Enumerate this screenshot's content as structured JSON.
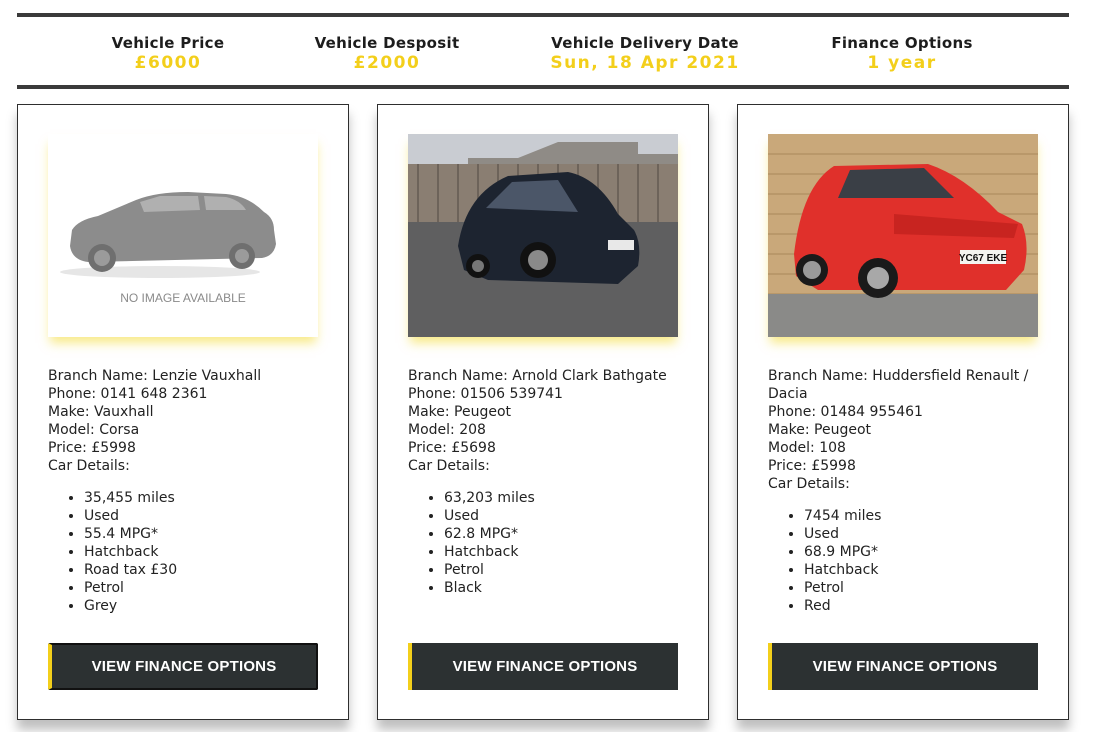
{
  "summary": [
    {
      "label": "Vehicle Price",
      "value": "£6000"
    },
    {
      "label": "Vehicle Desposit",
      "value": "£2000"
    },
    {
      "label": "Vehicle Delivery Date",
      "value": "Sun, 18 Apr 2021"
    },
    {
      "label": "Finance Options",
      "value": "1 year"
    }
  ],
  "colors": {
    "accent": "#f3cf1b",
    "button_bg": "#2c3132",
    "rule": "#3a3a3a"
  },
  "cards": [
    {
      "image_text": "NO IMAGE AVAILABLE",
      "branch": "Branch Name: Lenzie Vauxhall",
      "phone": "Phone: 0141 648 2361",
      "make": "Make: Vauxhall",
      "model": "Model: Corsa",
      "price": "Price: £5998",
      "details_label": "Car Details:",
      "details": [
        "35,455 miles",
        "Used",
        "55.4 MPG*",
        "Hatchback",
        "Road tax £30",
        "Petrol",
        "Grey"
      ],
      "button_label": "VIEW FINANCE OPTIONS"
    },
    {
      "branch": "Branch Name: Arnold Clark Bathgate",
      "phone": "Phone: 01506 539741",
      "make": "Make: Peugeot",
      "model": "Model: 208",
      "price": "Price: £5698",
      "details_label": "Car Details:",
      "details": [
        "63,203 miles",
        "Used",
        "62.8 MPG*",
        "Hatchback",
        "Petrol",
        "Black"
      ],
      "button_label": "VIEW FINANCE OPTIONS"
    },
    {
      "plate": "YC67 EKE",
      "branch": "Branch Name: Huddersfield Renault / Dacia",
      "phone": "Phone: 01484 955461",
      "make": "Make: Peugeot",
      "model": "Model: 108",
      "price": "Price: £5998",
      "details_label": "Car Details:",
      "details": [
        "7454 miles",
        "Used",
        "68.9 MPG*",
        "Hatchback",
        "Petrol",
        "Red"
      ],
      "button_label": "VIEW FINANCE OPTIONS"
    }
  ]
}
